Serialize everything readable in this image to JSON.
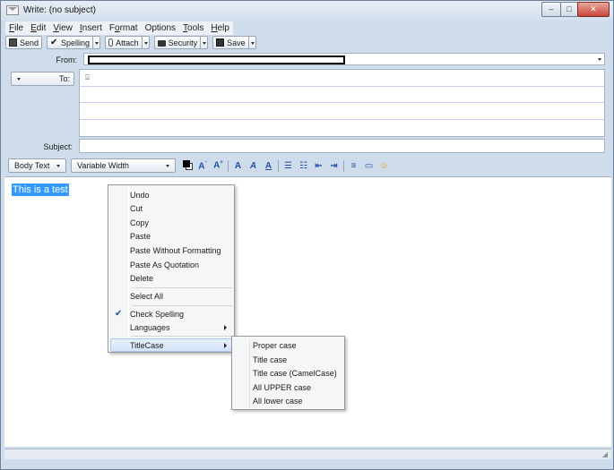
{
  "window": {
    "title": "Write: (no subject)",
    "controls": {
      "minimize": "–",
      "maximize": "□",
      "close": "✕"
    }
  },
  "menubar": {
    "items": [
      {
        "label": "File",
        "mnemonic": "F",
        "rest": "ile"
      },
      {
        "label": "Edit",
        "mnemonic": "E",
        "rest": "dit"
      },
      {
        "label": "View",
        "mnemonic": "V",
        "rest": "iew"
      },
      {
        "label": "Insert",
        "mnemonic": "I",
        "rest": "nsert"
      },
      {
        "label": "Format",
        "pre": "F",
        "mnemonic": "o",
        "rest": "rmat"
      },
      {
        "label": "Options",
        "mnemonic": "",
        "rest": "Options"
      },
      {
        "label": "Tools",
        "mnemonic": "T",
        "rest": "ools"
      },
      {
        "label": "Help",
        "mnemonic": "H",
        "rest": "elp"
      }
    ]
  },
  "toolbar": {
    "send": "Send",
    "spelling": "Spelling",
    "attach": "Attach",
    "security": "Security",
    "save": "Save"
  },
  "header": {
    "from_label": "From:",
    "to_label": "To:",
    "subject_label": "Subject:",
    "subject_value": "",
    "address_icon": "⍓"
  },
  "formatbar": {
    "paragraph_style": "Body Text",
    "font": "Variable Width",
    "text_color": "#000000",
    "background_color": "#ffffff",
    "icons": [
      "smaller-font-icon",
      "larger-font-icon",
      "bold-icon",
      "italic-icon",
      "underline-icon",
      "bullet-list-icon",
      "numbered-list-icon",
      "outdent-icon",
      "indent-icon",
      "align-icon",
      "insert-icon",
      "smiley-icon"
    ]
  },
  "editor": {
    "body_text": "This is a test",
    "selection_color": "#3399ff"
  },
  "context_menu": {
    "items": [
      {
        "label": "Undo"
      },
      {
        "label": "Cut"
      },
      {
        "label": "Copy"
      },
      {
        "label": "Paste"
      },
      {
        "label": "Paste Without Formatting"
      },
      {
        "label": "Paste As Quotation"
      },
      {
        "label": "Delete"
      },
      {
        "label": "Select All"
      },
      {
        "label": "Check Spelling",
        "checked": true
      },
      {
        "label": "Languages",
        "submenu": true
      },
      {
        "label": "TitleCase",
        "submenu": true,
        "highlighted": true
      }
    ]
  },
  "titlecase_submenu": {
    "items": [
      {
        "label": "Proper case"
      },
      {
        "label": "Title case"
      },
      {
        "label": "Title case (CamelCase)"
      },
      {
        "label": "All UPPER case"
      },
      {
        "label": "All lower case"
      }
    ]
  }
}
